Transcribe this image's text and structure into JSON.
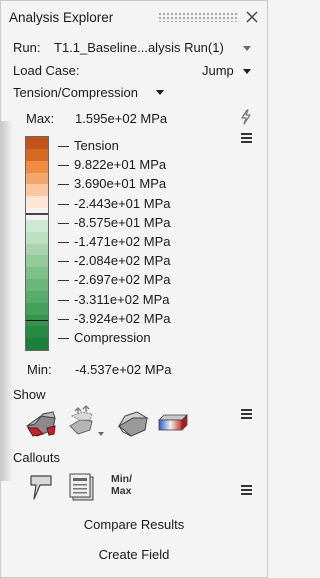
{
  "window": {
    "title": "Analysis Explorer"
  },
  "run": {
    "label": "Run:",
    "value": "T1.1_Baseline...alysis Run(1)"
  },
  "load_case": {
    "label": "Load Case:",
    "value": "Jump"
  },
  "result_type": {
    "value": "Tension/Compression"
  },
  "legend": {
    "max_label": "Max:",
    "max_value": "1.595e+02 MPa",
    "min_label": "Min:",
    "min_value": "-4.537e+02 MPa",
    "labels": [
      "Tension",
      "9.822e+01 MPa",
      "3.690e+01 MPa",
      "-2.443e+01 MPa",
      "-8.575e+01 MPa",
      "-1.471e+02 MPa",
      "-2.084e+02 MPa",
      "-2.697e+02 MPa",
      "-3.311e+02 MPa",
      "-3.924e+02 MPa",
      "Compression"
    ],
    "colors": [
      "#c2531b",
      "#d4691f",
      "#ee8c41",
      "#f6a56d",
      "#fbc7a2",
      "#fde6d6",
      "#f2f2f2",
      "#cfe8d3",
      "#bddfc2",
      "#a7d3ad",
      "#94ca9c",
      "#7ec08a",
      "#6bb67b",
      "#58ab6b",
      "#469f5c",
      "#36934e",
      "#288944",
      "#1d7f3b"
    ]
  },
  "show": {
    "title": "Show",
    "icons": [
      "deformed-shape-icon",
      "animation-icon",
      "undeformed-shape-icon",
      "contour-display-icon"
    ]
  },
  "callouts": {
    "title": "Callouts",
    "minmax_label_1": "Min/",
    "minmax_label_2": "Max",
    "icons": [
      "callout-probe-icon",
      "callout-list-icon",
      "min-max-callout-icon"
    ]
  },
  "actions": {
    "compare_results": "Compare Results",
    "create_field": "Create Field"
  },
  "theme": {
    "panel_bg": "#f4f4f4",
    "accent_red": "#c0262e",
    "accent_blue": "#2a5fc8"
  }
}
